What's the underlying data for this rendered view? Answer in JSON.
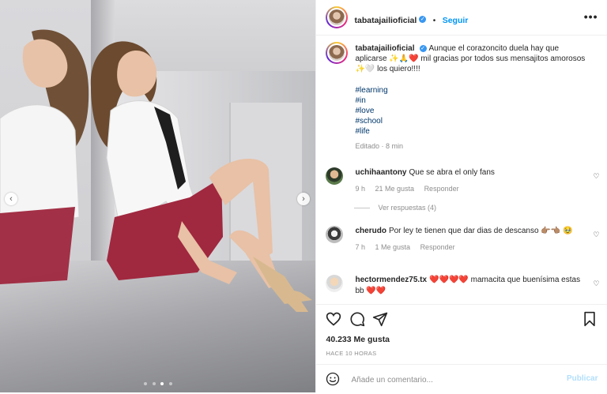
{
  "post": {
    "author": "tabatajailioficial",
    "follow_label": "Seguir",
    "more_label": "•••",
    "caption_text": "Aunque el corazoncito duela hay que aplicarse ✨🙏❤️ mil gracias por todos sus mensajitos amorosos ✨🤍 los quiero!!!!",
    "hashtags": [
      "#learning",
      "#in",
      "#love",
      "#school",
      "#life"
    ],
    "edited": "Editado · 8 min",
    "likes": "40.233 Me gusta",
    "time_ago": "HACE 10 HORAS",
    "comment_placeholder": "Añade un comentario...",
    "publish_label": "Publicar"
  },
  "comments": [
    {
      "user": "uchihaantony",
      "text": "Que se abra el only fans",
      "time": "9 h",
      "likes": "21 Me gusta",
      "reply": "Responder",
      "view_replies": "Ver respuestas (4)"
    },
    {
      "user": "cherudo",
      "text": "Por ley te tienen que dar dias de descanso 👉🏽👈🏽 🥹",
      "time": "7 h",
      "likes": "1 Me gusta",
      "reply": "Responder"
    },
    {
      "user": "hectormendez75.tx",
      "text": "❤️❤️❤️❤️ mamacita que buenísima estas bb ❤️❤️"
    }
  ],
  "icons": {
    "nav_prev": "‹",
    "nav_next": "›",
    "heart_small": "♡",
    "verified": "✓"
  },
  "colors": {
    "accent": "#0095f6",
    "hashtag": "#00376b",
    "muted": "#8e8e8e"
  }
}
